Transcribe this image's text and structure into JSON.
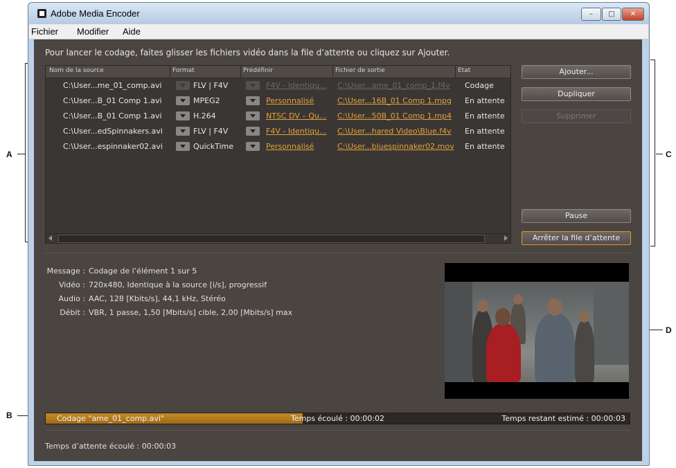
{
  "callouts": {
    "a": "A",
    "b": "B",
    "c": "C",
    "d": "D"
  },
  "window": {
    "title": "Adobe Media Encoder",
    "minimize_glyph": "–",
    "maximize_glyph": "□",
    "close_glyph": "✕"
  },
  "menu": {
    "items": [
      "Fichier",
      "Modifier",
      "Aide"
    ]
  },
  "instructions": "Pour lancer le codage, faites glisser les fichiers vidéo dans la file d’attente ou cliquez sur Ajouter.",
  "queue": {
    "columns": [
      "Nom de la source",
      "Format",
      "Prédéfinir",
      "Fichier de sortie",
      "Etat"
    ],
    "rows": [
      {
        "source": "C:\\User...me_01_comp.avi",
        "format": "FLV | F4V",
        "preset": "F4V - Identiqu...",
        "output": "C:\\User...ame_01_comp_1.f4v",
        "state": "Codage",
        "active": true
      },
      {
        "source": "C:\\User...B_01 Comp 1.avi",
        "format": "MPEG2",
        "preset": "Personnalisé",
        "output": "C:\\User...16B_01 Comp 1.mpg",
        "state": "En attente",
        "active": false
      },
      {
        "source": "C:\\User...B_01 Comp 1.avi",
        "format": "H.264",
        "preset": "NTSC DV – Qu...",
        "output": "C:\\User...50B_01 Comp 1.mp4",
        "state": "En attente",
        "active": false
      },
      {
        "source": "C:\\User...edSpinnakers.avi",
        "format": "FLV | F4V",
        "preset": "F4V - Identiqu...",
        "output": "C:\\User...hared Video\\Blue.f4v",
        "state": "En attente",
        "active": false
      },
      {
        "source": "C:\\User...espinnaker02.avi",
        "format": "QuickTime",
        "preset": "Personnalisé",
        "output": "C:\\User...bluespinnaker02.mov",
        "state": "En attente",
        "active": false
      }
    ]
  },
  "buttons": {
    "add": "Ajouter...",
    "duplicate": "Dupliquer",
    "remove": "Supprimer",
    "pause": "Pause",
    "stop_queue": "Arrêter la file d’attente"
  },
  "message": {
    "labels": {
      "message": "Message :",
      "video": "Vidéo :",
      "audio": "Audio :",
      "bitrate": "Débit :"
    },
    "message": "Codage de l’élément 1 sur 5",
    "video": "720x480, Identique à la source [i/s], progressif",
    "audio": "AAC, 128 [Kbits/s], 44,1 kHz, Stéréo",
    "bitrate": "VBR, 1 passe, 1,50 [Mbits/s] cible, 2,00 [Mbits/s] max"
  },
  "progress": {
    "label": "Codage \"ame_01_comp.avi\"",
    "elapsed": "Temps écoulé : 00:00:02",
    "remaining": "Temps restant estimé : 00:00:03",
    "fraction": 0.44
  },
  "queue_elapsed": "Temps d’attente écoulé :  00:00:03",
  "colors": {
    "accent": "#e5a13b",
    "panel": "#4a4541",
    "progress_fill": "#b67a1e"
  }
}
